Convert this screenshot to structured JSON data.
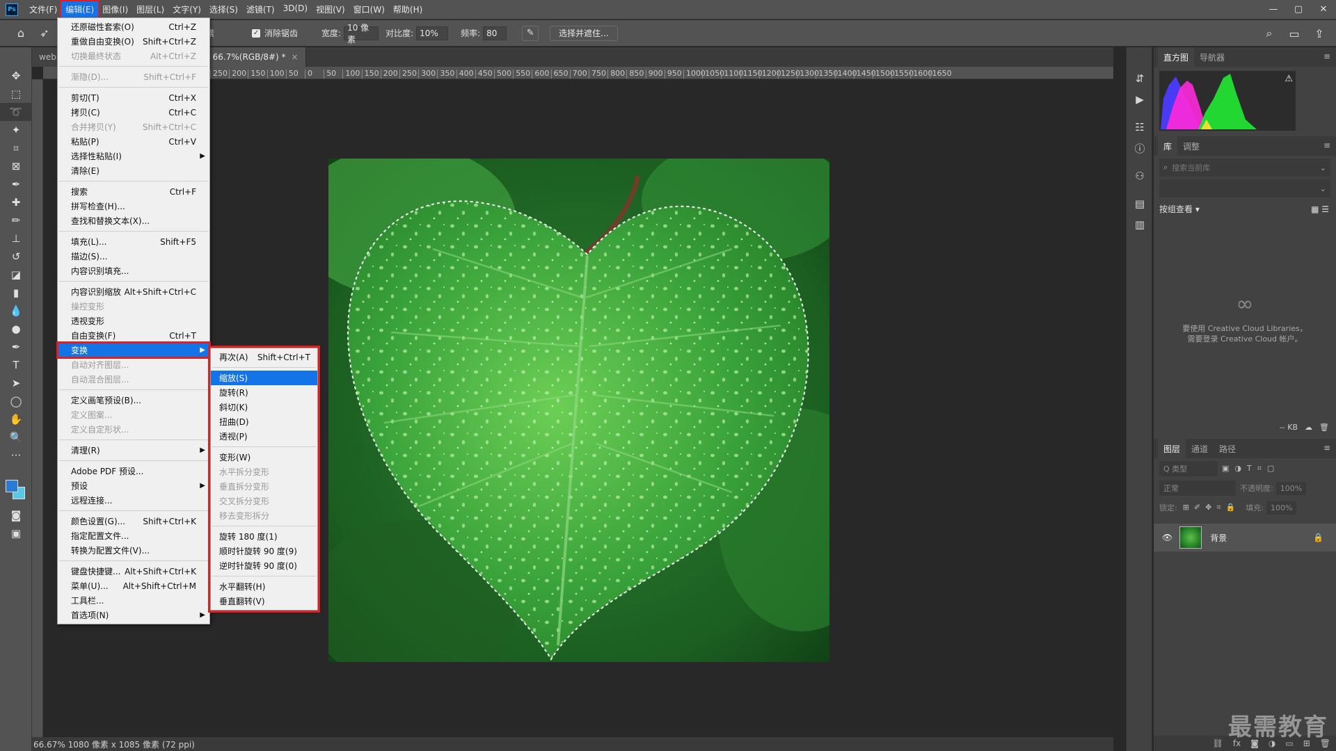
{
  "app": {
    "logo_text": "Ps"
  },
  "menubar": {
    "items": [
      "文件(F)",
      "编辑(E)",
      "图像(I)",
      "图层(L)",
      "文字(Y)",
      "选择(S)",
      "滤镜(T)",
      "3D(D)",
      "视图(V)",
      "窗口(W)",
      "帮助(H)"
    ],
    "active_index": 1
  },
  "window_controls": {
    "minimize": "—",
    "maximize": "▢",
    "close": "✕"
  },
  "options": {
    "feather_tail": "素",
    "antialias_label": "消除锯齿",
    "width_label": "宽度:",
    "width_value": "10 像素",
    "contrast_label": "对比度:",
    "contrast_value": "10%",
    "frequency_label": "频率:",
    "frequency_value": "80",
    "select_mask_label": "选择并遮住..."
  },
  "doc_tabs": [
    {
      "label": "webu",
      "active": false
    },
    {
      "label": "6.jpg @ 66.7%(RGB/8#) *",
      "active": true
    }
  ],
  "ruler_top": [
    "250",
    "200",
    "150",
    "100",
    "50",
    "0",
    "50",
    "100",
    "150",
    "200",
    "250",
    "300",
    "350",
    "400",
    "450",
    "500",
    "550",
    "600",
    "650",
    "700",
    "750",
    "800",
    "850",
    "900",
    "950",
    "1000",
    "1050",
    "1100",
    "1150",
    "1200",
    "1250",
    "1300",
    "1350",
    "1400",
    "1450",
    "1500",
    "1550",
    "1600",
    "1650"
  ],
  "status": {
    "text": "66.67%  1080 像素 x 1085 像素 (72 ppi)"
  },
  "edit_menu": {
    "groups": [
      [
        {
          "label": "还原磁性套索(O)",
          "shortcut": "Ctrl+Z"
        },
        {
          "label": "重做自由变换(O)",
          "shortcut": "Shift+Ctrl+Z"
        },
        {
          "label": "切换最终状态",
          "shortcut": "Alt+Ctrl+Z",
          "disabled": true
        }
      ],
      [
        {
          "label": "渐隐(D)...",
          "shortcut": "Shift+Ctrl+F",
          "disabled": true
        }
      ],
      [
        {
          "label": "剪切(T)",
          "shortcut": "Ctrl+X"
        },
        {
          "label": "拷贝(C)",
          "shortcut": "Ctrl+C"
        },
        {
          "label": "合并拷贝(Y)",
          "shortcut": "Shift+Ctrl+C",
          "disabled": true
        },
        {
          "label": "粘贴(P)",
          "shortcut": "Ctrl+V"
        },
        {
          "label": "选择性粘贴(I)",
          "shortcut": "",
          "submenu": true
        },
        {
          "label": "清除(E)",
          "shortcut": ""
        }
      ],
      [
        {
          "label": "搜索",
          "shortcut": "Ctrl+F"
        },
        {
          "label": "拼写检查(H)...",
          "shortcut": ""
        },
        {
          "label": "查找和替换文本(X)...",
          "shortcut": ""
        }
      ],
      [
        {
          "label": "填充(L)...",
          "shortcut": "Shift+F5"
        },
        {
          "label": "描边(S)...",
          "shortcut": ""
        },
        {
          "label": "内容识别填充...",
          "shortcut": ""
        }
      ],
      [
        {
          "label": "内容识别缩放",
          "shortcut": "Alt+Shift+Ctrl+C"
        },
        {
          "label": "操控变形",
          "shortcut": "",
          "disabled": true
        },
        {
          "label": "透视变形",
          "shortcut": ""
        },
        {
          "label": "自由变换(F)",
          "shortcut": "Ctrl+T"
        },
        {
          "label": "变换",
          "shortcut": "",
          "submenu": true,
          "highlight": true
        },
        {
          "label": "自动对齐图层...",
          "shortcut": "",
          "disabled": true
        },
        {
          "label": "自动混合图层...",
          "shortcut": "",
          "disabled": true
        }
      ],
      [
        {
          "label": "定义画笔预设(B)...",
          "shortcut": ""
        },
        {
          "label": "定义图案...",
          "shortcut": "",
          "disabled": true
        },
        {
          "label": "定义自定形状...",
          "shortcut": "",
          "disabled": true
        }
      ],
      [
        {
          "label": "清理(R)",
          "shortcut": "",
          "submenu": true
        }
      ],
      [
        {
          "label": "Adobe PDF 预设...",
          "shortcut": ""
        },
        {
          "label": "预设",
          "shortcut": "",
          "submenu": true
        },
        {
          "label": "远程连接...",
          "shortcut": ""
        }
      ],
      [
        {
          "label": "颜色设置(G)...",
          "shortcut": "Shift+Ctrl+K"
        },
        {
          "label": "指定配置文件...",
          "shortcut": ""
        },
        {
          "label": "转换为配置文件(V)...",
          "shortcut": ""
        }
      ],
      [
        {
          "label": "键盘快捷键...",
          "shortcut": "Alt+Shift+Ctrl+K"
        },
        {
          "label": "菜单(U)...",
          "shortcut": "Alt+Shift+Ctrl+M"
        },
        {
          "label": "工具栏...",
          "shortcut": ""
        },
        {
          "label": "首选项(N)",
          "shortcut": "",
          "submenu": true
        }
      ]
    ]
  },
  "transform_menu": {
    "groups": [
      [
        {
          "label": "再次(A)",
          "shortcut": "Shift+Ctrl+T"
        }
      ],
      [
        {
          "label": "缩放(S)",
          "shortcut": "",
          "highlight": true
        },
        {
          "label": "旋转(R)",
          "shortcut": ""
        },
        {
          "label": "斜切(K)",
          "shortcut": ""
        },
        {
          "label": "扭曲(D)",
          "shortcut": ""
        },
        {
          "label": "透视(P)",
          "shortcut": ""
        }
      ],
      [
        {
          "label": "变形(W)",
          "shortcut": ""
        },
        {
          "label": "水平拆分变形",
          "shortcut": "",
          "disabled": true
        },
        {
          "label": "垂直拆分变形",
          "shortcut": "",
          "disabled": true
        },
        {
          "label": "交叉拆分变形",
          "shortcut": "",
          "disabled": true
        },
        {
          "label": "移去变形拆分",
          "shortcut": "",
          "disabled": true
        }
      ],
      [
        {
          "label": "旋转 180 度(1)",
          "shortcut": ""
        },
        {
          "label": "顺时针旋转 90 度(9)",
          "shortcut": ""
        },
        {
          "label": "逆时针旋转 90 度(0)",
          "shortcut": ""
        }
      ],
      [
        {
          "label": "水平翻转(H)",
          "shortcut": ""
        },
        {
          "label": "垂直翻转(V)",
          "shortcut": ""
        }
      ]
    ]
  },
  "panels": {
    "histogram_tabs": [
      "直方图",
      "导航器"
    ],
    "library_tabs": [
      "库",
      "调整"
    ],
    "library_search_placeholder": "搜索当前库",
    "library_view": "按组查看 ▾",
    "library_empty_line1": "要使用 Creative Cloud Libraries，",
    "library_empty_line2": "需要登录 Creative Cloud 帐户。",
    "library_size": "-- KB",
    "layers_tabs": [
      "图层",
      "通道",
      "路径"
    ],
    "layers_filter": "Q 类型",
    "blend_mode": "正常",
    "opacity_label": "不透明度:",
    "opacity_value": "100%",
    "lock_label": "锁定:",
    "fill_label": "填充:",
    "fill_value": "100%",
    "background_layer": "背景"
  },
  "watermark": "最需教育",
  "colors": {
    "accent": "#1473e6",
    "highlight_border": "#e02020",
    "fg": "#2a7bd6",
    "bg": "#59c7e8"
  }
}
